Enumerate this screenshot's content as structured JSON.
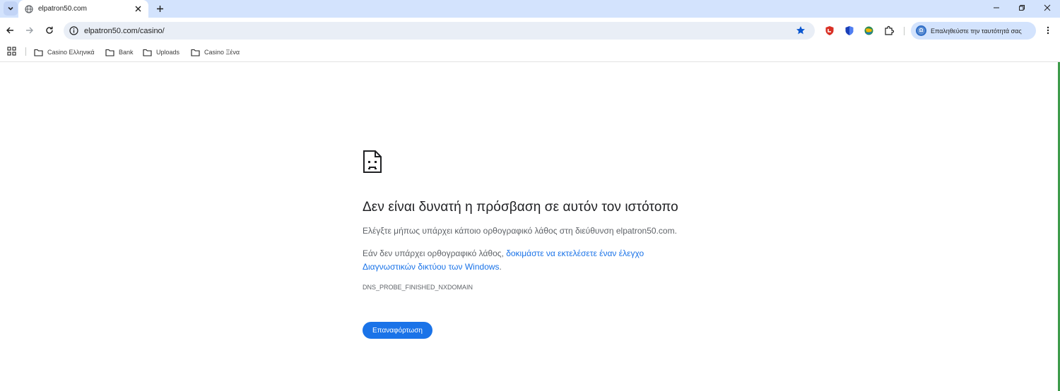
{
  "browser": {
    "tab": {
      "title": "elpatron50.com",
      "favicon": "globe-icon"
    },
    "window_controls": [
      "minimize-icon",
      "restore-icon",
      "close-icon"
    ],
    "address_bar": {
      "url": "elpatron50.com/casino/"
    },
    "extensions": [
      "shield-red-icon",
      "shield-blue-icon",
      "globe-extension-icon",
      "puzzle-icon"
    ],
    "profile_chip": {
      "label": "Επαληθεύστε την ταυτότητά σας"
    },
    "bookmarks": [
      {
        "label": "Casino Ελληνικά"
      },
      {
        "label": "Bank"
      },
      {
        "label": "Uploads"
      },
      {
        "label": "Casino Ξένα"
      }
    ]
  },
  "error_page": {
    "title": "Δεν είναι δυνατή η πρόσβαση σε αυτόν τον ιστότοπο",
    "line1": "Ελέγξτε μήπως υπάρχει κάποιο ορθογραφικό λάθος στη διεύθυνση elpatron50.com.",
    "line2_prefix": "Εάν δεν υπάρχει ορθογραφικό λάθος, ",
    "line2_link": "δοκιμάστε να εκτελέσετε έναν έλεγχο Διαγνωστικών δικτύου των Windows",
    "line2_suffix": ".",
    "error_code": "DNS_PROBE_FINISHED_NXDOMAIN",
    "reload_button": "Επαναφόρτωση"
  },
  "colors": {
    "tabstrip": "#d3e3fd",
    "accent": "#1a73e8",
    "omnibox": "#e9eef6"
  }
}
